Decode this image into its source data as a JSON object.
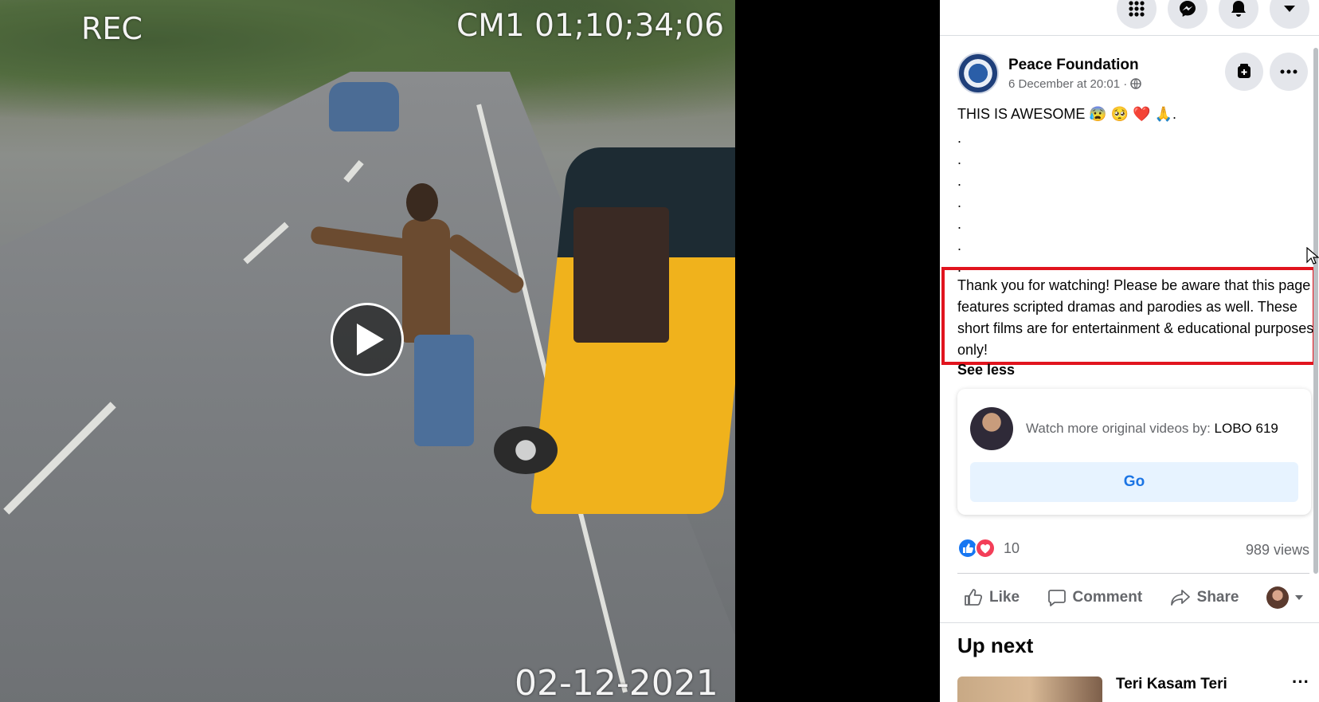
{
  "video": {
    "rec_label": "REC",
    "camera_label": "CM1 01;10;34;06",
    "date_label": "02-12-2021"
  },
  "topbar": {
    "icons": [
      "grid-icon",
      "messenger-icon",
      "bell-icon",
      "chevron-down-icon"
    ]
  },
  "post": {
    "page_name": "Peace Foundation",
    "timestamp": "6 December at 20:01 ·",
    "headline": "THIS IS AWESOME 😰 🥺 ❤️ 🙏.",
    "dots": [
      ".",
      ".",
      ".",
      ".",
      ".",
      ".",
      "."
    ],
    "disclaimer": "Thank you for watching! Please be aware that this page features scripted dramas and parodies as well. These short films are for entertainment & educational purposes only!",
    "see_less": "See less",
    "highlight_color": "#e1141e"
  },
  "promo": {
    "prefix": "Watch more original videos by: ",
    "creator": "LOBO 619",
    "go_label": "Go"
  },
  "stats": {
    "reaction_count": "10",
    "views": "989 views"
  },
  "actions": {
    "like": "Like",
    "comment": "Comment",
    "share": "Share"
  },
  "up_next": {
    "heading": "Up next",
    "first_title": "Teri Kasam Teri",
    "more": "···"
  },
  "colors": {
    "accent": "#1877f2",
    "go_text": "#1b74e4",
    "love": "#f33e58"
  }
}
